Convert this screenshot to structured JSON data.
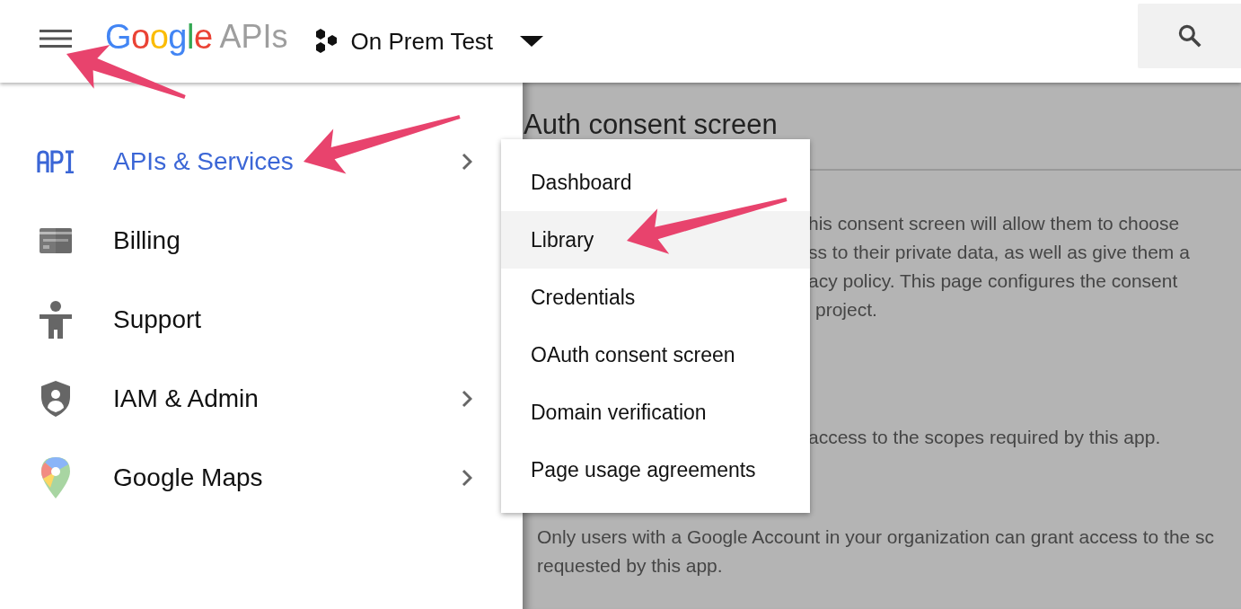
{
  "header": {
    "logo": "Google",
    "product": "APIs",
    "project": "On Prem Test"
  },
  "sidebar": {
    "items": [
      {
        "kind": "api",
        "label": "APIs & Services",
        "selected": true,
        "has_submenu": true
      },
      {
        "kind": "billing",
        "label": "Billing",
        "selected": false,
        "has_submenu": false
      },
      {
        "kind": "support",
        "label": "Support",
        "selected": false,
        "has_submenu": false
      },
      {
        "kind": "iam",
        "label": "IAM & Admin",
        "selected": false,
        "has_submenu": true
      },
      {
        "kind": "maps",
        "label": "Google Maps",
        "selected": false,
        "has_submenu": true
      }
    ]
  },
  "submenu": {
    "items": [
      {
        "label": "Dashboard",
        "selected": false
      },
      {
        "label": "Library",
        "selected": true
      },
      {
        "label": "Credentials",
        "selected": false
      },
      {
        "label": "OAuth consent screen",
        "selected": false
      },
      {
        "label": "Domain verification",
        "selected": false
      },
      {
        "label": "Page usage agreements",
        "selected": false
      }
    ]
  },
  "page": {
    "title": "Auth consent screen",
    "intro_lines": [
      "his consent screen will allow them to choose",
      "ss to their private data, as well as give them a",
      "acy policy. This page configures the consent",
      "project."
    ],
    "scope_line": "access to the scopes required by this app.",
    "internal_lines": [
      "Only users with a Google Account in your organization can grant access to the sc",
      "requested by this app."
    ]
  }
}
